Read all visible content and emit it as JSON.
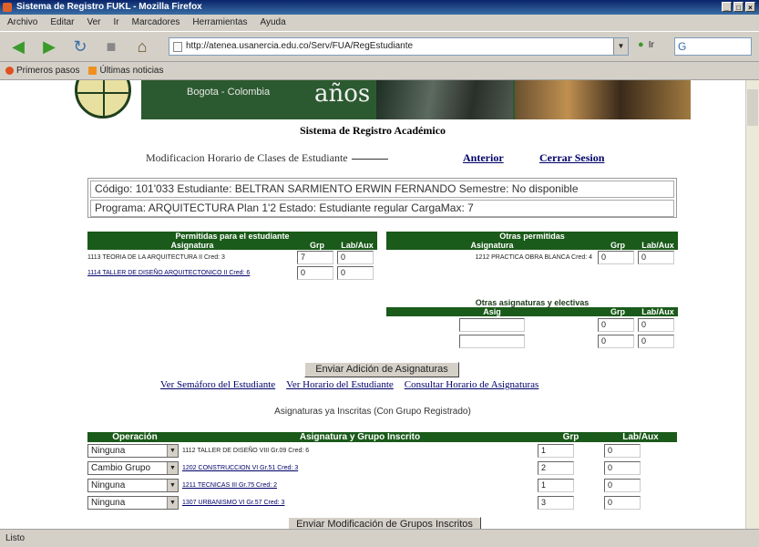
{
  "window": {
    "title": "Sistema de Registro FUKL - Mozilla Firefox",
    "controls": [
      "_",
      "□",
      "×"
    ]
  },
  "menu": [
    "Archivo",
    "Editar",
    "Ver",
    "Ir",
    "Marcadores",
    "Herramientas",
    "Ayuda"
  ],
  "toolbar": {
    "url": "http://atenea.usanercia.edu.co/Serv/FUA/RegEstudiante",
    "go_label": "Ir",
    "go_icon": "go-icon"
  },
  "bookmarks": [
    "Primeros pasos",
    "Últimas noticias"
  ],
  "status": "Listo",
  "banner": {
    "city": "Bogota - Colombia",
    "anos": "años"
  },
  "page": {
    "system_title": "Sistema de Registro Académico",
    "modification_label": "Modificacion Horario de Clases de Estudiante",
    "anterior": "Anterior",
    "cerrar": "Cerrar Sesion",
    "info_line1": "Código: 101'033   Estudiante: BELTRAN SARMIENTO ERWIN FERNANDO   Semestre: No disponible",
    "info_line2": "Programa: ARQUITECTURA Plan 1'2   Estado: Estudiante regular   CargaMax: 7"
  },
  "permitidas": {
    "title": "Permitidas para el estudiante",
    "cols": [
      "Asignatura",
      "Grp",
      "Lab/Aux"
    ],
    "rows": [
      {
        "asignatura": "1113 TEORIA DE LA ARQUITECTURA II  Cred: 3",
        "grp": "7",
        "lab": "0"
      },
      {
        "asignatura": "1114 TALLER DE DISEÑO ARQUITECTONICO II  Cred: 6",
        "grp": "0",
        "lab": "0"
      }
    ]
  },
  "otras": {
    "title": "Otras permitidas",
    "cols": [
      "Asignatura",
      "Grp",
      "Lab/Aux"
    ],
    "rows": [
      {
        "asignatura": "1212 PRACTICA OBRA BLANCA Cred: 4",
        "grp": "0",
        "lab": "0"
      }
    ]
  },
  "electivas": {
    "title": "Otras asignaturas y electivas",
    "cols": [
      "Asig",
      "Grp",
      "Lab/Aux"
    ],
    "rows": [
      {
        "asig": "",
        "grp": "0",
        "lab": "0"
      },
      {
        "asig": "",
        "grp": "0",
        "lab": "0"
      }
    ]
  },
  "enviar_adicion": "Enviar Adición de Asignaturas",
  "links": [
    "Ver Semáforo del Estudiante",
    "Ver Horario del Estudiante",
    "Consultar Horario de Asignaturas"
  ],
  "inscritas": {
    "title": "Asignaturas ya Inscritas (Con Grupo Registrado)",
    "cols": [
      "Operación",
      "Asignatura y Grupo Inscrito",
      "Grp",
      "Lab/Aux"
    ],
    "rows": [
      {
        "op": "Ninguna",
        "asignatura": "1112 TALLER DE DISEÑO VIII Gr.09 Cred: 6",
        "grp": "1",
        "lab": "0"
      },
      {
        "op": "Cambio Grupo",
        "asignatura": "1202 CONSTRUCCION VI Gr.51 Cred: 3",
        "grp": "2",
        "lab": "0"
      },
      {
        "op": "Ninguna",
        "asignatura": "1211 TECNICAS III Gr.75 Cred: 2",
        "grp": "1",
        "lab": "0"
      },
      {
        "op": "Ninguna",
        "asignatura": "1307 URBANISMO VI Gr.57 Cred: 3",
        "grp": "3",
        "lab": "0"
      }
    ]
  },
  "enviar_mod": "Enviar Modificación de Grupos Inscritos"
}
